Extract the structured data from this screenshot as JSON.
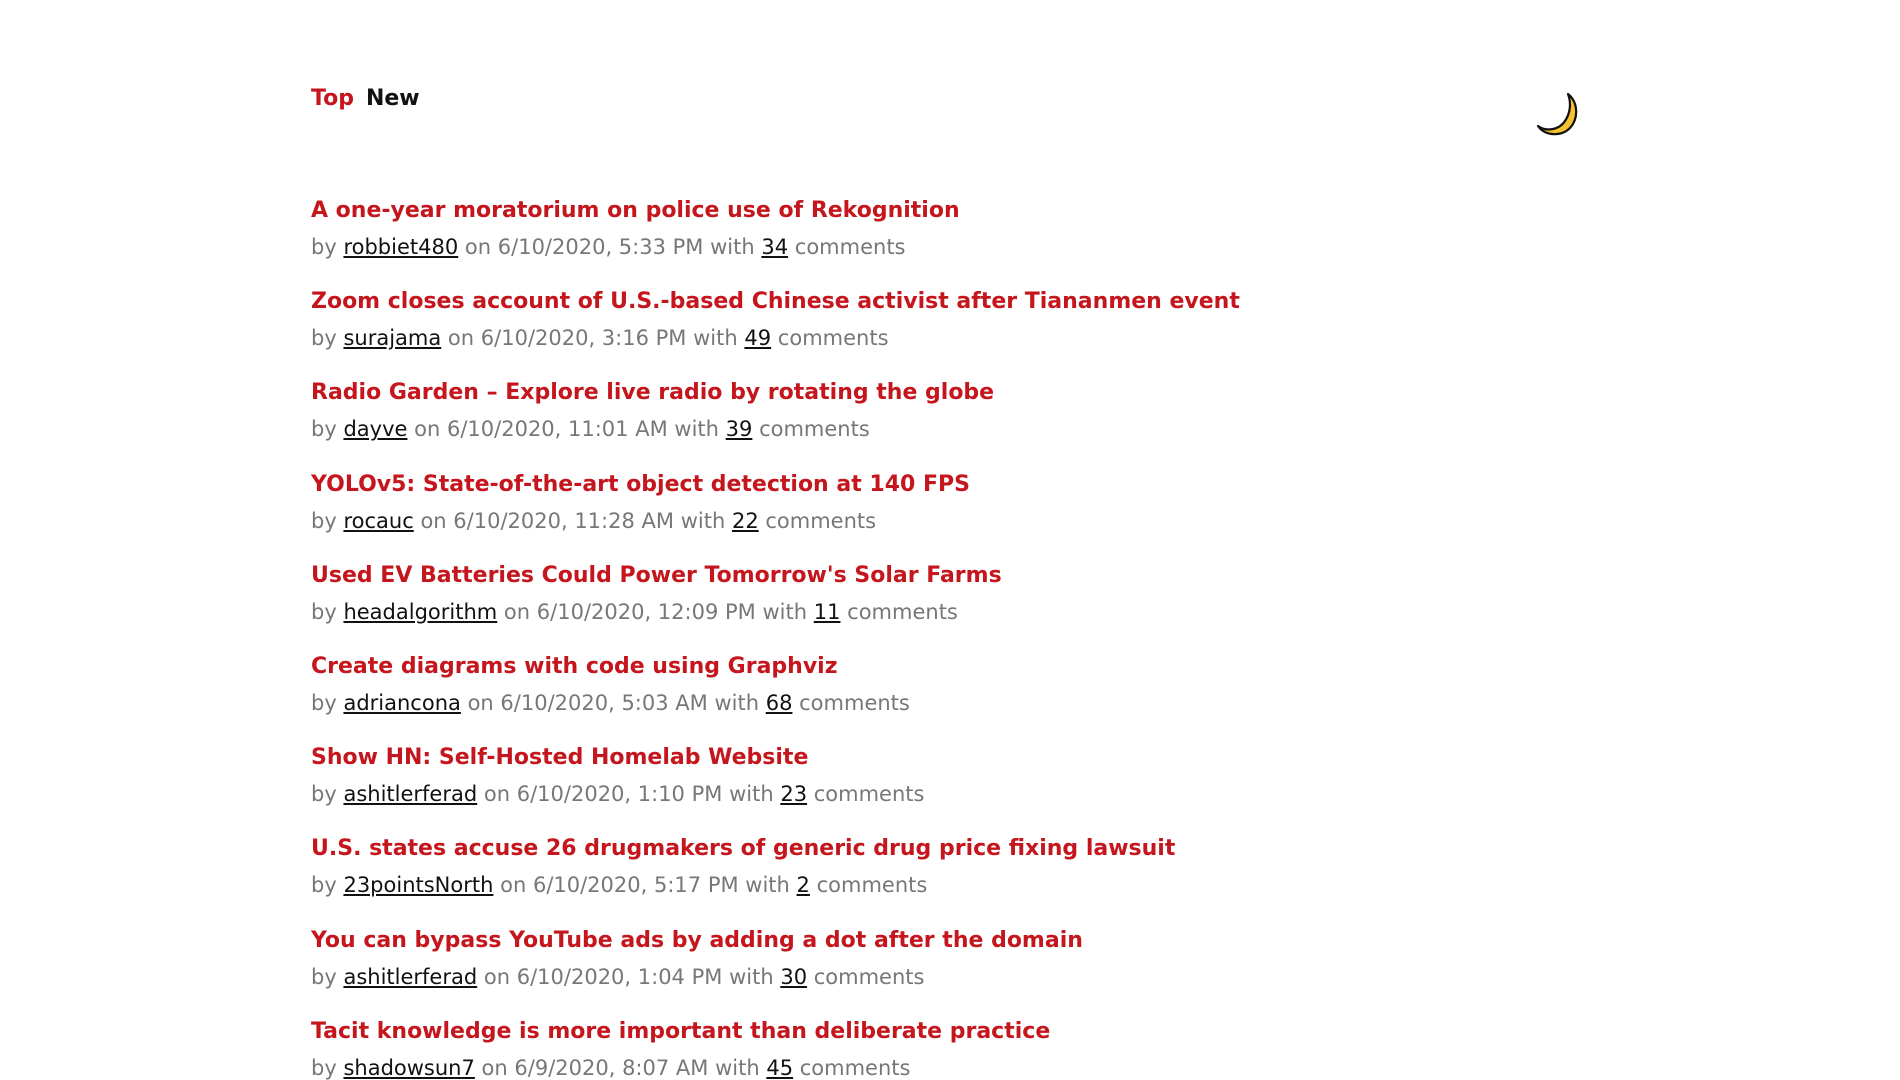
{
  "nav": {
    "tabs": [
      {
        "label": "Top",
        "active": true
      },
      {
        "label": "New",
        "active": false
      }
    ]
  },
  "theme_toggle": {
    "icon": "crescent-moon-icon",
    "color": "#f6c12f"
  },
  "colors": {
    "accent": "#c4161c",
    "meta_text": "#777777",
    "link_text": "#111111"
  },
  "meta_words": {
    "by": "by",
    "on": "on",
    "with": "with",
    "comments": "comments"
  },
  "stories": [
    {
      "title": "A one-year moratorium on police use of Rekognition",
      "author": "robbiet480",
      "date": "6/10/2020, 5:33 PM",
      "comments": "34"
    },
    {
      "title": "Zoom closes account of U.S.-based Chinese activist after Tiananmen event",
      "author": "surajama",
      "date": "6/10/2020, 3:16 PM",
      "comments": "49"
    },
    {
      "title": "Radio Garden – Explore live radio by rotating the globe",
      "author": "dayve",
      "date": "6/10/2020, 11:01 AM",
      "comments": "39"
    },
    {
      "title": "YOLOv5: State-of-the-art object detection at 140 FPS",
      "author": "rocauc",
      "date": "6/10/2020, 11:28 AM",
      "comments": "22"
    },
    {
      "title": "Used EV Batteries Could Power Tomorrow's Solar Farms",
      "author": "headalgorithm",
      "date": "6/10/2020, 12:09 PM",
      "comments": "11"
    },
    {
      "title": "Create diagrams with code using Graphviz",
      "author": "adriancona",
      "date": "6/10/2020, 5:03 AM",
      "comments": "68"
    },
    {
      "title": "Show HN: Self-Hosted Homelab Website",
      "author": "ashitlerferad",
      "date": "6/10/2020, 1:10 PM",
      "comments": "23"
    },
    {
      "title": "U.S. states accuse 26 drugmakers of generic drug price fixing lawsuit",
      "author": "23pointsNorth",
      "date": "6/10/2020, 5:17 PM",
      "comments": "2"
    },
    {
      "title": "You can bypass YouTube ads by adding a dot after the domain",
      "author": "ashitlerferad",
      "date": "6/10/2020, 1:04 PM",
      "comments": "30"
    },
    {
      "title": "Tacit knowledge is more important than deliberate practice",
      "author": "shadowsun7",
      "date": "6/9/2020, 8:07 AM",
      "comments": "45"
    }
  ]
}
